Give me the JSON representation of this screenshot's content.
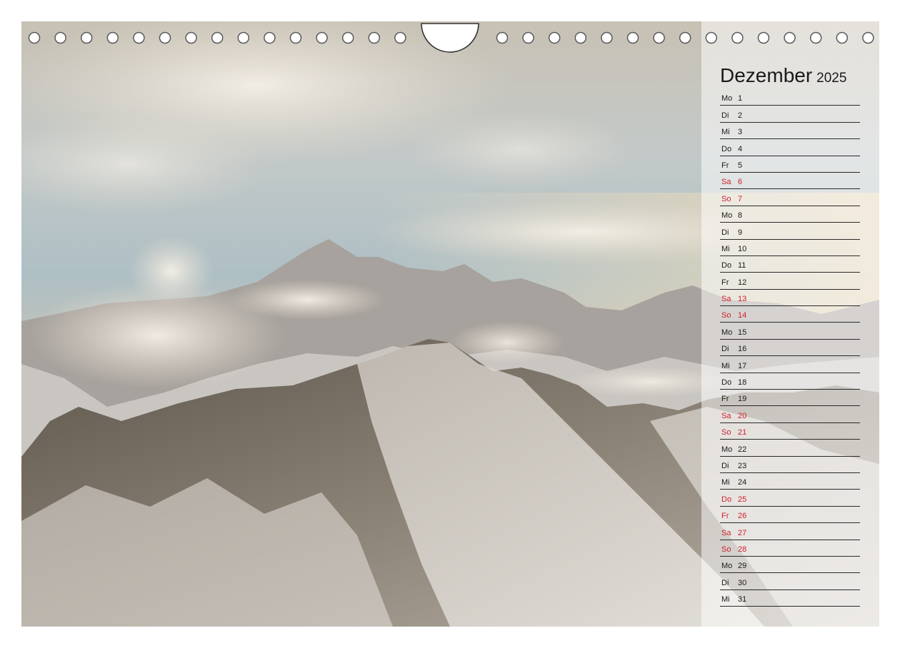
{
  "calendar": {
    "month": "Dezember",
    "year": "2025",
    "days": [
      {
        "wd": "Mo",
        "d": "1",
        "holiday": false
      },
      {
        "wd": "Di",
        "d": "2",
        "holiday": false
      },
      {
        "wd": "Mi",
        "d": "3",
        "holiday": false
      },
      {
        "wd": "Do",
        "d": "4",
        "holiday": false
      },
      {
        "wd": "Fr",
        "d": "5",
        "holiday": false
      },
      {
        "wd": "Sa",
        "d": "6",
        "holiday": true
      },
      {
        "wd": "So",
        "d": "7",
        "holiday": true
      },
      {
        "wd": "Mo",
        "d": "8",
        "holiday": false
      },
      {
        "wd": "Di",
        "d": "9",
        "holiday": false
      },
      {
        "wd": "Mi",
        "d": "10",
        "holiday": false
      },
      {
        "wd": "Do",
        "d": "11",
        "holiday": false
      },
      {
        "wd": "Fr",
        "d": "12",
        "holiday": false
      },
      {
        "wd": "Sa",
        "d": "13",
        "holiday": true
      },
      {
        "wd": "So",
        "d": "14",
        "holiday": true
      },
      {
        "wd": "Mo",
        "d": "15",
        "holiday": false
      },
      {
        "wd": "Di",
        "d": "16",
        "holiday": false
      },
      {
        "wd": "Mi",
        "d": "17",
        "holiday": false
      },
      {
        "wd": "Do",
        "d": "18",
        "holiday": false
      },
      {
        "wd": "Fr",
        "d": "19",
        "holiday": false
      },
      {
        "wd": "Sa",
        "d": "20",
        "holiday": true
      },
      {
        "wd": "So",
        "d": "21",
        "holiday": true
      },
      {
        "wd": "Mo",
        "d": "22",
        "holiday": false
      },
      {
        "wd": "Di",
        "d": "23",
        "holiday": false
      },
      {
        "wd": "Mi",
        "d": "24",
        "holiday": false
      },
      {
        "wd": "Do",
        "d": "25",
        "holiday": true
      },
      {
        "wd": "Fr",
        "d": "26",
        "holiday": true
      },
      {
        "wd": "Sa",
        "d": "27",
        "holiday": true
      },
      {
        "wd": "So",
        "d": "28",
        "holiday": true
      },
      {
        "wd": "Mo",
        "d": "29",
        "holiday": false
      },
      {
        "wd": "Di",
        "d": "30",
        "holiday": false
      },
      {
        "wd": "Mi",
        "d": "31",
        "holiday": false
      }
    ]
  },
  "colors": {
    "holiday_red": "#d0202e",
    "text": "#1a1a1a",
    "rule": "#2a2a2a"
  },
  "photo": {
    "subject": "snow-covered-mountain-ridge-with-clouds"
  }
}
